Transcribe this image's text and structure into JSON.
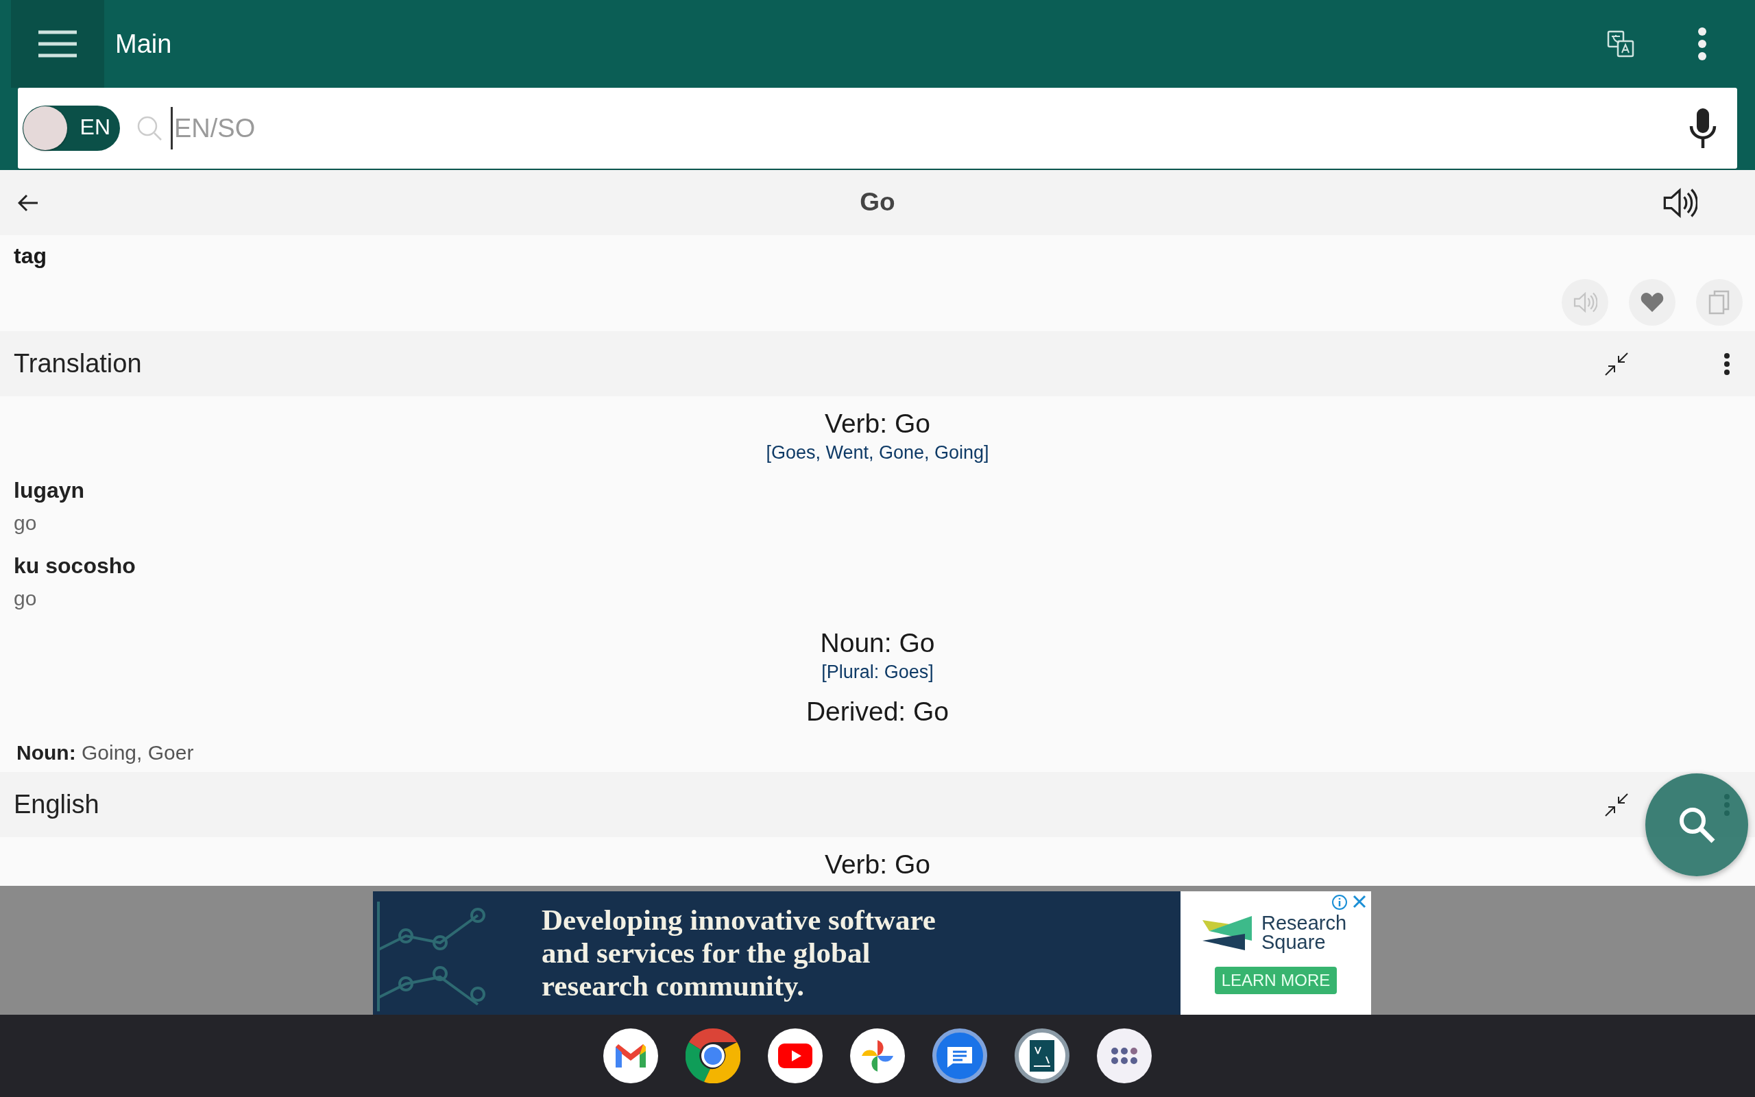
{
  "app_bar": {
    "title": "Main"
  },
  "search": {
    "language": "EN",
    "toggle_on": true,
    "placeholder": "EN/SO"
  },
  "word_header": {
    "title": "Go"
  },
  "entry": {
    "tag": "tag"
  },
  "sections": [
    {
      "title": "Translation",
      "blocks": [
        {
          "kind": "heading",
          "text": "Verb: Go"
        },
        {
          "kind": "forms",
          "text": "[Goes, Went, Gone, Going]"
        },
        {
          "kind": "term",
          "term": "lugayn",
          "gloss": "go"
        },
        {
          "kind": "term",
          "term": "ku socosho",
          "gloss": "go"
        },
        {
          "kind": "heading",
          "text": "Noun: Go"
        },
        {
          "kind": "forms",
          "text": "[Plural: Goes]"
        },
        {
          "kind": "heading",
          "text": "Derived: Go"
        },
        {
          "kind": "derived",
          "text": "**Noun:** Going, Goer"
        }
      ]
    },
    {
      "title": "English",
      "blocks": [
        {
          "kind": "heading",
          "text": "Verb: Go"
        }
      ]
    }
  ],
  "ad": {
    "headline": "Developing innovative software and services for the global research community.",
    "brand": "Research Square",
    "button": "LEARN MORE"
  }
}
